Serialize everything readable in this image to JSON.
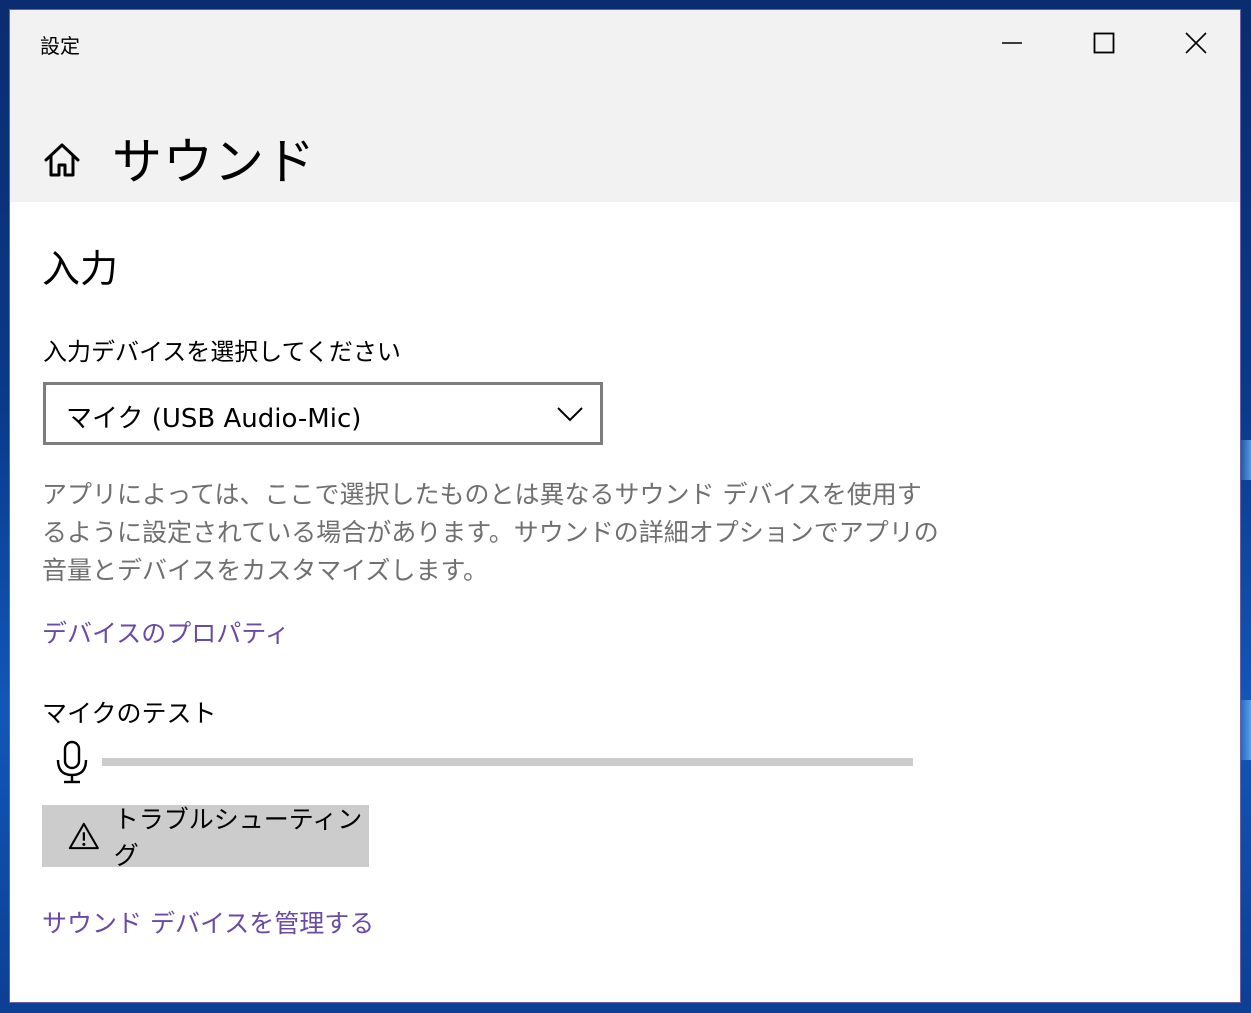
{
  "window": {
    "app_title": "設定"
  },
  "header": {
    "page_title": "サウンド"
  },
  "input_section": {
    "heading": "入力",
    "device_label": "入力デバイスを選択してください",
    "device_selected": "マイク (USB Audio-Mic)",
    "description": "アプリによっては、ここで選択したものとは異なるサウンド デバイスを使用するように設定されている場合があります。サウンドの詳細オプションでアプリの音量とデバイスをカスタマイズします。",
    "device_properties_link": "デバイスのプロパティ",
    "mic_test_label": "マイクのテスト",
    "mic_level": 0,
    "troubleshoot_label": "トラブルシューティング",
    "manage_devices_link": "サウンド デバイスを管理する"
  },
  "colors": {
    "accent_link": "#6b4aa6",
    "description_text": "#707070",
    "titlebar_bg": "#f2f2f2",
    "button_bg": "#cccccc"
  },
  "icons": {
    "home": "home-icon",
    "chevron": "chevron-down-icon",
    "mic": "microphone-icon",
    "warning": "warning-icon",
    "minimize": "minimize-icon",
    "maximize": "maximize-icon",
    "close": "close-icon"
  }
}
